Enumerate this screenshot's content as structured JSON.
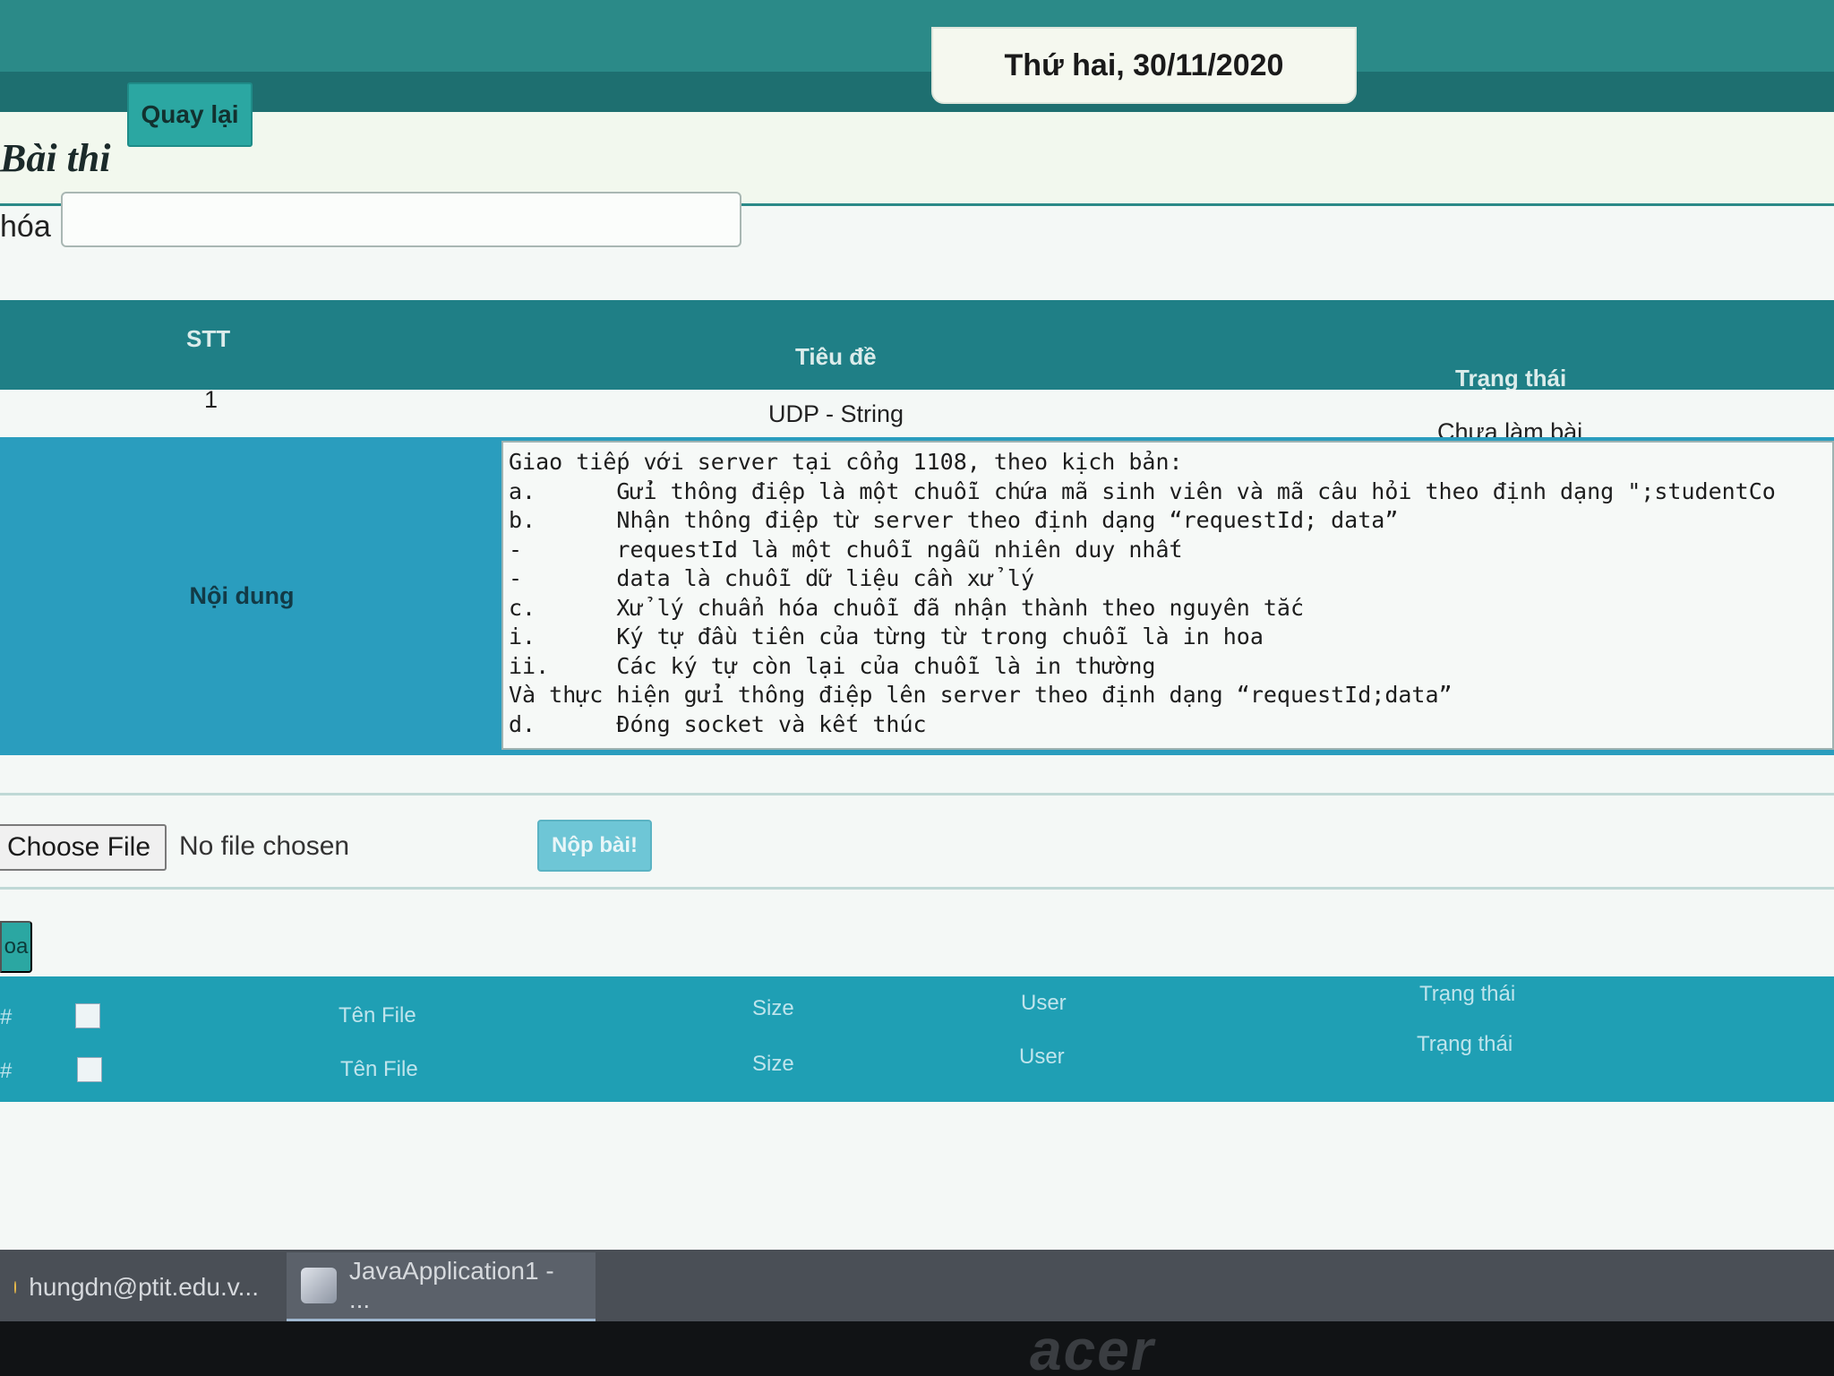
{
  "header": {
    "date": "Thứ hai, 30/11/2020"
  },
  "page": {
    "title": "Bài thi",
    "back_label": "Quay lại",
    "filter_label": "hóa",
    "filter_value": ""
  },
  "exam_table": {
    "columns": [
      "STT",
      "Tiêu đề",
      "Trạng thái"
    ],
    "row": {
      "stt": "1",
      "title": "UDP - String",
      "status": "Chưa làm bài"
    },
    "content_label": "Nội dung",
    "content_lines": [
      "Giao tiếp với server tại cổng 1108, theo kịch bản:",
      "a.      Gửi thông điệp là một chuỗi chứa mã sinh viên và mã câu hỏi theo định dạng \";studentCo",
      "b.      Nhận thông điệp từ server theo định dạng “requestId; data”",
      "-       requestId là một chuỗi ngẫu nhiên duy nhất",
      "-       data là chuỗi dữ liệu cần xử lý",
      "c.      Xử lý chuẩn hóa chuỗi đã nhận thành theo nguyên tắc",
      "i.      Ký tự đầu tiên của từng từ trong chuỗi là in hoa",
      "ii.     Các ký tự còn lại của chuỗi là in thường",
      "Và thực hiện gửi thông điệp lên server theo định dạng “requestId;data”",
      "d.      Đóng socket và kết thúc"
    ]
  },
  "upload": {
    "choose_file_label": "Choose File",
    "file_status": "No file chosen",
    "submit_label": "Nộp bài!"
  },
  "side_button_label": "oa",
  "files_table": {
    "rows": [
      {
        "index": "#",
        "name": "Tên File",
        "size": "Size",
        "user": "User",
        "status": "Trạng thái"
      },
      {
        "index": "#",
        "name": "Tên File",
        "size": "Size",
        "user": "User",
        "status": "Trạng thái"
      }
    ]
  },
  "taskbar": {
    "items": [
      {
        "label": "hungdn@ptit.edu.v..."
      },
      {
        "label": "JavaApplication1 - ..."
      }
    ]
  },
  "bezel_brand": "acer"
}
